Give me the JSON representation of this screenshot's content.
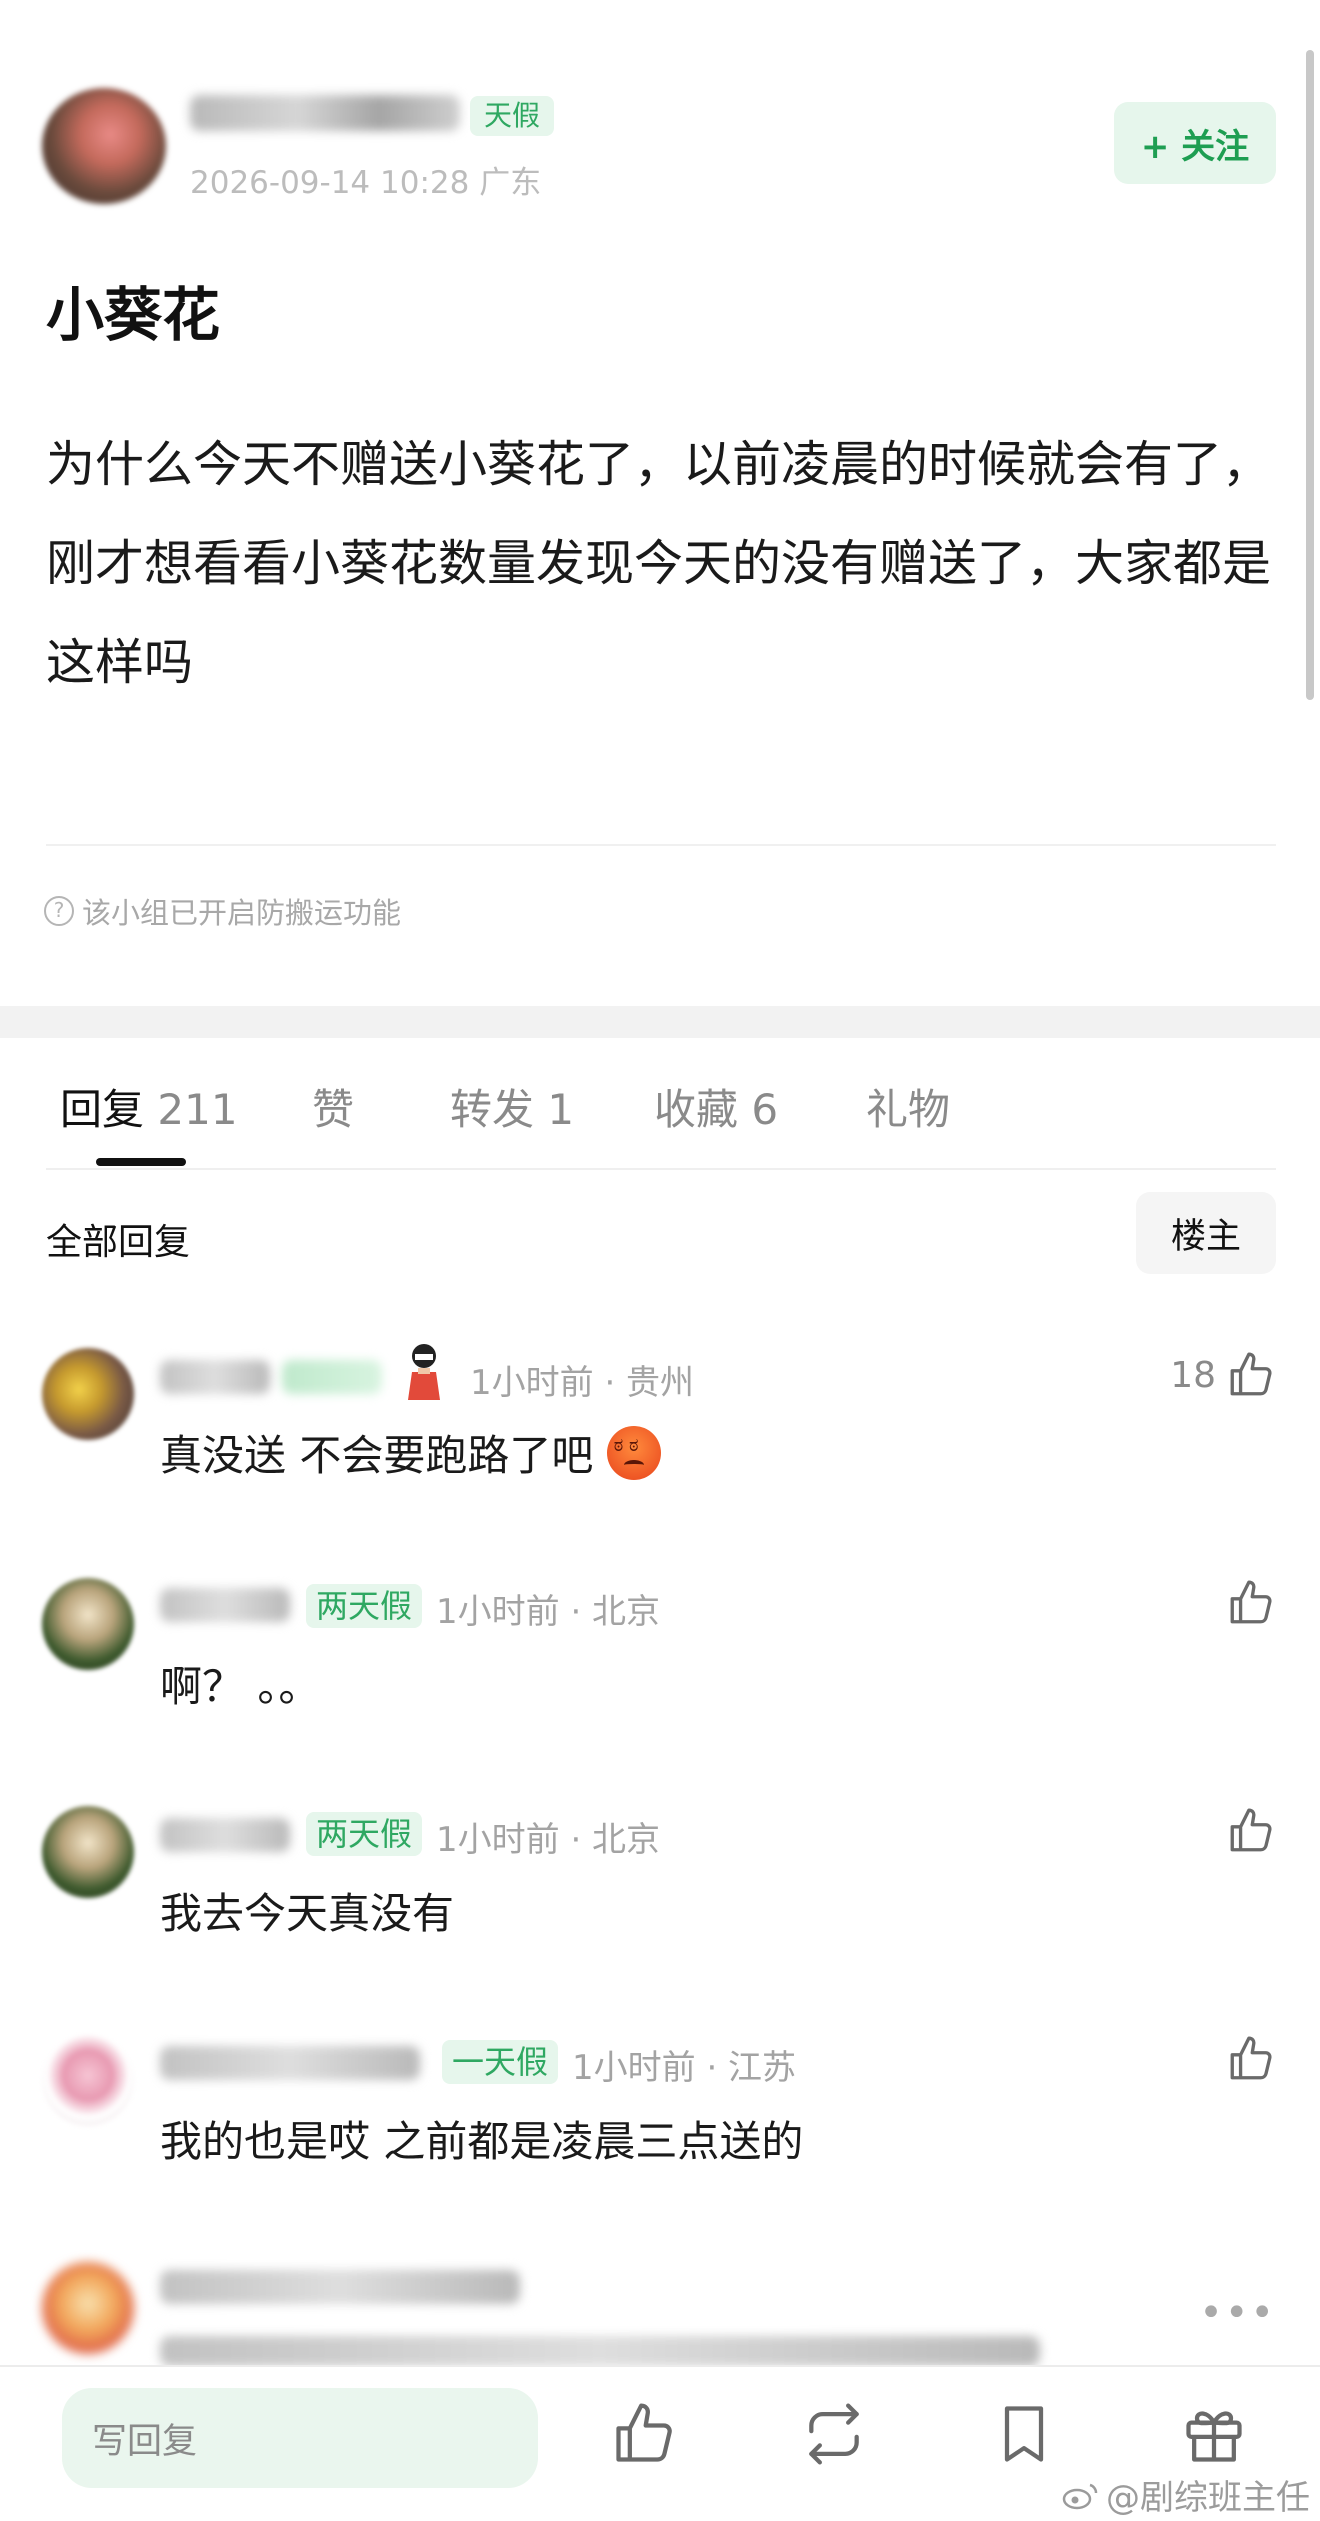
{
  "post": {
    "author_badge": "天假",
    "meta": "2026-09-14 10:28  广东",
    "follow_label": "+ 关注",
    "title": "小葵花",
    "body": "为什么今天不赠送小葵花了，以前凌晨的时候就会有了，刚才想看看小葵花数量发现今天的没有赠送了，大家都是这样吗",
    "notice": "该小组已开启防搬运功能"
  },
  "tabs": [
    {
      "label": "回复",
      "count": "211"
    },
    {
      "label": "赞",
      "count": ""
    },
    {
      "label": "转发",
      "count": "1"
    },
    {
      "label": "收藏",
      "count": "6"
    },
    {
      "label": "礼物",
      "count": ""
    }
  ],
  "replies_header": {
    "title": "全部回复",
    "owner_filter": "楼主"
  },
  "comments": [
    {
      "badge": "",
      "meta": "1小时前 · 贵州",
      "text": "真没送 不会要跑路了吧",
      "likes": "18"
    },
    {
      "badge": "两天假",
      "meta": "1小时前 · 北京",
      "text": "啊？ 。。",
      "likes": ""
    },
    {
      "badge": "两天假",
      "meta": "1小时前 · 北京",
      "text": "我去今天真没有",
      "likes": ""
    },
    {
      "badge": "一天假",
      "meta": "1小时前 · 江苏",
      "text": "我的也是哎 之前都是凌晨三点送的",
      "likes": ""
    }
  ],
  "bottom_bar": {
    "reply_placeholder": "写回复"
  },
  "watermark": "@剧综班主任",
  "colors": {
    "accent_green": "#1e9e52",
    "tag_bg": "#e6f6ec"
  }
}
